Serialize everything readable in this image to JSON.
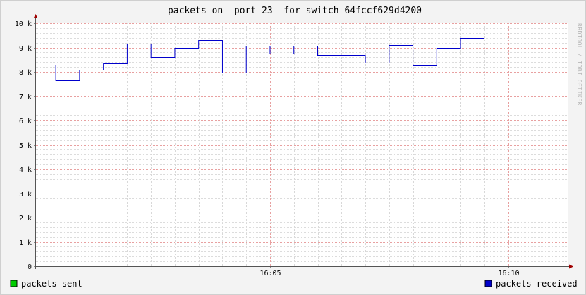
{
  "title": "packets on  port 23  for switch 64fccf629d4200",
  "watermark": "RRDTOOL / TOBI OETIKER",
  "chart_data": {
    "type": "line",
    "step": true,
    "title": "packets on  port 23  for switch 64fccf629d4200",
    "y_ticks": [
      {
        "value": 0,
        "label": "0"
      },
      {
        "value": 1000,
        "label": "1 k"
      },
      {
        "value": 2000,
        "label": "2 k"
      },
      {
        "value": 3000,
        "label": "3 k"
      },
      {
        "value": 4000,
        "label": "4 k"
      },
      {
        "value": 5000,
        "label": "5 k"
      },
      {
        "value": 6000,
        "label": "6 k"
      },
      {
        "value": 7000,
        "label": "7 k"
      },
      {
        "value": 8000,
        "label": "8 k"
      },
      {
        "value": 9000,
        "label": "9 k"
      },
      {
        "value": 10000,
        "label": "10 k"
      }
    ],
    "ylim": [
      0,
      10000
    ],
    "x_range": [
      "16:00:05",
      "16:11:15"
    ],
    "x_ticks": [
      {
        "time": "16:05:00",
        "label": "16:05"
      },
      {
        "time": "16:10:00",
        "label": "16:10"
      }
    ],
    "x_minor_step_seconds": 30,
    "grid": true,
    "legend": [
      {
        "name": "packets sent",
        "color": "#00cc00",
        "position": "bottom-left"
      },
      {
        "name": "packets received",
        "color": "#0000cc",
        "position": "bottom-right"
      }
    ],
    "series": [
      {
        "name": "packets received",
        "color": "#0000cc",
        "points": [
          {
            "start": "16:00:05",
            "end": "16:00:30",
            "value": 8280
          },
          {
            "start": "16:00:30",
            "end": "16:01:00",
            "value": 7650
          },
          {
            "start": "16:01:00",
            "end": "16:01:30",
            "value": 8100
          },
          {
            "start": "16:01:30",
            "end": "16:02:00",
            "value": 8350
          },
          {
            "start": "16:02:00",
            "end": "16:02:30",
            "value": 9150
          },
          {
            "start": "16:02:30",
            "end": "16:03:00",
            "value": 8620
          },
          {
            "start": "16:03:00",
            "end": "16:03:30",
            "value": 9000
          },
          {
            "start": "16:03:30",
            "end": "16:04:00",
            "value": 9290
          },
          {
            "start": "16:04:00",
            "end": "16:04:30",
            "value": 7970
          },
          {
            "start": "16:04:30",
            "end": "16:05:00",
            "value": 9070
          },
          {
            "start": "16:05:00",
            "end": "16:05:30",
            "value": 8740
          },
          {
            "start": "16:05:30",
            "end": "16:06:00",
            "value": 9070
          },
          {
            "start": "16:06:00",
            "end": "16:07:00",
            "value": 8710
          },
          {
            "start": "16:07:00",
            "end": "16:07:30",
            "value": 8380
          },
          {
            "start": "16:07:30",
            "end": "16:08:00",
            "value": 9100
          },
          {
            "start": "16:08:00",
            "end": "16:08:30",
            "value": 8250
          },
          {
            "start": "16:08:30",
            "end": "16:09:00",
            "value": 8980
          },
          {
            "start": "16:09:00",
            "end": "16:09:30",
            "value": 9380
          }
        ]
      }
    ]
  }
}
